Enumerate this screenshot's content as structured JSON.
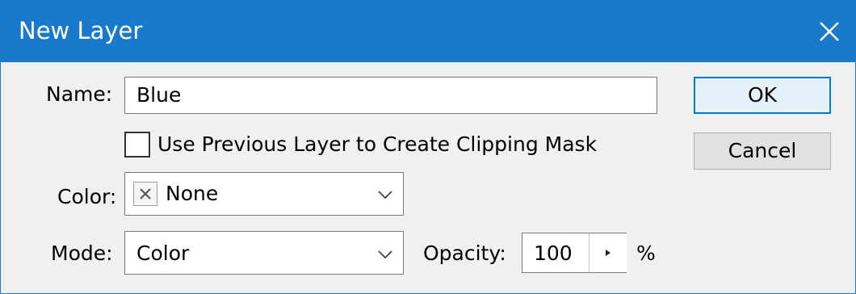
{
  "window": {
    "title": "New Layer",
    "titlebar_color": "#1979ca",
    "close_icon": "close-icon"
  },
  "form": {
    "name_label": "Name:",
    "name_value": "Blue",
    "clipping_checkbox_label": "Use Previous Layer to Create Clipping Mask",
    "clipping_checked": false,
    "color_label": "Color:",
    "color_value": "None",
    "color_swatch_icon": "no-color-x-icon",
    "mode_label": "Mode:",
    "mode_value": "Color",
    "opacity_label": "Opacity:",
    "opacity_value": "100",
    "opacity_unit": "%"
  },
  "buttons": {
    "ok": "OK",
    "cancel": "Cancel"
  }
}
